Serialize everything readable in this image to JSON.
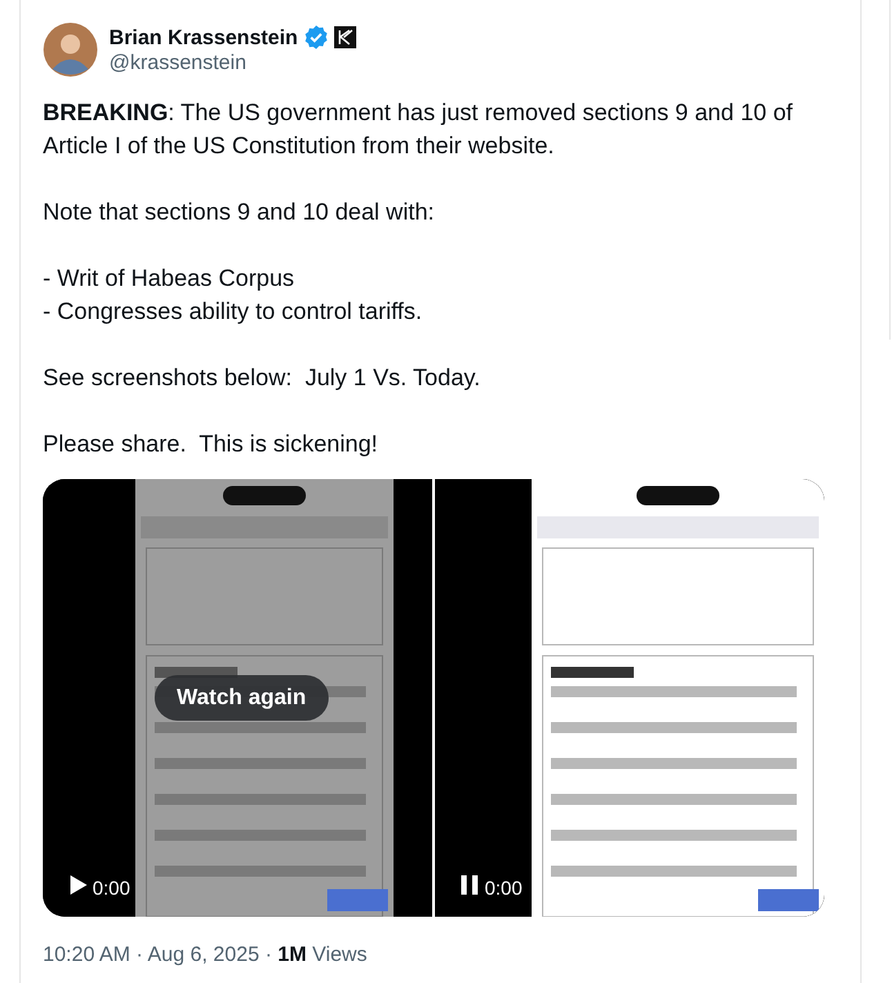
{
  "author": {
    "name": "Brian Krassenstein",
    "verified": true,
    "handle": "@krassenstein"
  },
  "body": [
    {
      "lines": [
        "**BREAKING**: The US government has just removed sections 9 and 10 of Article I of the US Constitution from their website."
      ]
    },
    {
      "lines": [
        "Note that sections 9 and 10 deal with:"
      ]
    },
    {
      "lines": [
        "- Writ of Habeas Corpus",
        "- Congresses ability to control tariffs."
      ]
    },
    {
      "lines": [
        "See screenshots below:  July 1 Vs. Today."
      ]
    },
    {
      "lines": [
        "Please share.  This is sickening!"
      ]
    }
  ],
  "media": [
    {
      "kind": "picture",
      "playing": false,
      "overlay": "Watch again",
      "time": "0:00"
    },
    {
      "kind": "picture",
      "playing": true,
      "time": "0:00"
    }
  ],
  "meta": "10:20 AM · Aug 6, 2025 · **1M** Views"
}
